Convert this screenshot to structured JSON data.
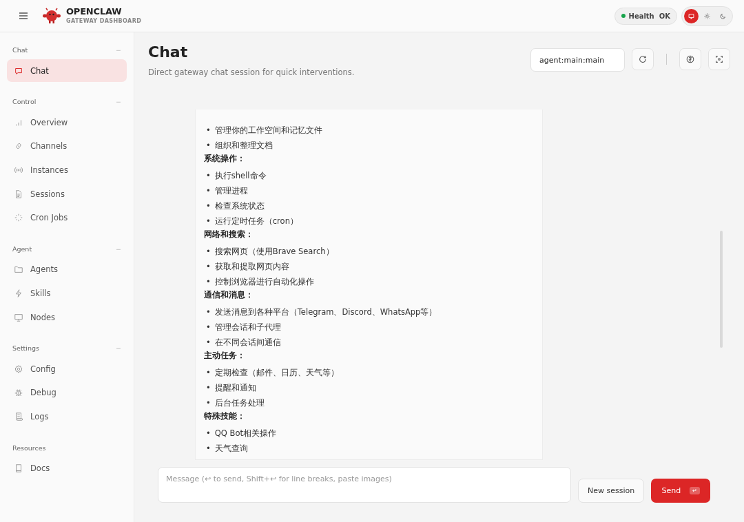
{
  "brand": {
    "name": "OPENCLAW",
    "subtitle": "GATEWAY DASHBOARD"
  },
  "health": {
    "label": "Health",
    "value": "OK",
    "ok": true
  },
  "theme_buttons": [
    {
      "kind": "system",
      "selected": true
    },
    {
      "kind": "light",
      "selected": false
    },
    {
      "kind": "dark",
      "selected": false
    }
  ],
  "sidebar": [
    {
      "title": "Chat",
      "toggle": "−",
      "items": [
        {
          "label": "Chat",
          "selected": true
        }
      ]
    },
    {
      "title": "Control",
      "toggle": "−",
      "items": [
        {
          "label": "Overview",
          "selected": false
        },
        {
          "label": "Channels",
          "selected": false
        },
        {
          "label": "Instances",
          "selected": false
        },
        {
          "label": "Sessions",
          "selected": false
        },
        {
          "label": "Cron Jobs",
          "selected": false
        }
      ]
    },
    {
      "title": "Agent",
      "toggle": "−",
      "items": [
        {
          "label": "Agents",
          "selected": false
        },
        {
          "label": "Skills",
          "selected": false
        },
        {
          "label": "Nodes",
          "selected": false
        }
      ]
    },
    {
      "title": "Settings",
      "toggle": "−",
      "items": [
        {
          "label": "Config",
          "selected": false
        },
        {
          "label": "Debug",
          "selected": false
        },
        {
          "label": "Logs",
          "selected": false
        }
      ]
    },
    {
      "title": "Resources",
      "items": [
        {
          "label": "Docs",
          "selected": false
        }
      ]
    }
  ],
  "page": {
    "title": "Chat",
    "subtitle": "Direct gateway chat session for quick interventions.",
    "session_key": "agent:main:main"
  },
  "message": [
    {
      "kind": "bullets",
      "marker": "•",
      "items": [
        "管理你的工作空间和记忆文件",
        "组织和整理文档"
      ]
    },
    {
      "kind": "heading",
      "text": "系统操作："
    },
    {
      "kind": "bullets",
      "marker": "•",
      "items": [
        "执行shell命令",
        "管理进程",
        "检查系统状态",
        "运行定时任务（cron）"
      ]
    },
    {
      "kind": "heading",
      "text": "网络和搜索："
    },
    {
      "kind": "bullets",
      "marker": "•",
      "items": [
        "搜索网页（使用Brave Search）",
        "获取和提取网页内容",
        "控制浏览器进行自动化操作"
      ]
    },
    {
      "kind": "heading",
      "text": "通信和消息："
    },
    {
      "kind": "bullets",
      "marker": "•",
      "items": [
        "发送消息到各种平台（Telegram、Discord、WhatsApp等）",
        "管理会话和子代理",
        "在不同会话间通信"
      ]
    },
    {
      "kind": "heading",
      "text": "主动任务："
    },
    {
      "kind": "bullets",
      "marker": "•",
      "items": [
        "定期检查（邮件、日历、天气等）",
        "提醒和通知",
        "后台任务处理"
      ]
    },
    {
      "kind": "heading",
      "text": "特殊技能："
    },
    {
      "kind": "bullets",
      "marker": "•",
      "items": [
        "QQ Bot相关操作",
        "天气查询"
      ]
    }
  ],
  "composer": {
    "placeholder": "Message (↩ to send, Shift+↩ for line breaks, paste images)",
    "new_session": "New session",
    "send": "Send",
    "send_key": "↵"
  }
}
